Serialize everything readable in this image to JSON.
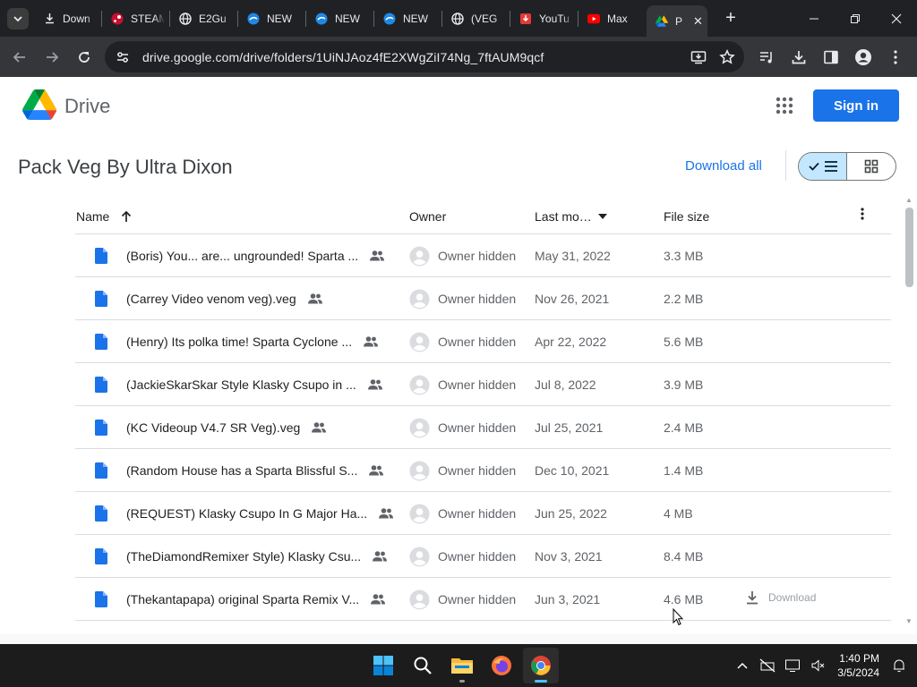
{
  "browser": {
    "tabs": [
      {
        "title": "Down",
        "icon": "download-icon"
      },
      {
        "title": "STEAM",
        "icon": "steam-icon"
      },
      {
        "title": "E2Gu",
        "icon": "globe-icon"
      },
      {
        "title": "NEW",
        "icon": "blue-cloud-icon"
      },
      {
        "title": "NEW",
        "icon": "blue-cloud-icon"
      },
      {
        "title": "NEW",
        "icon": "blue-cloud-icon"
      },
      {
        "title": "(VEG",
        "icon": "globe-icon"
      },
      {
        "title": "YouTu",
        "icon": "red-download-icon"
      },
      {
        "title": "Max",
        "icon": "youtube-icon"
      },
      {
        "title": "P",
        "icon": "drive-icon",
        "active": true
      }
    ],
    "url": "drive.google.com/drive/folders/1UiNJAoz4fE2XWgZiI74Ng_7ftAUM9qcf"
  },
  "drive": {
    "app_name": "Drive",
    "sign_in": "Sign in",
    "folder_title": "Pack Veg By Ultra Dixon",
    "download_all": "Download all",
    "columns": {
      "name": "Name",
      "owner": "Owner",
      "last_modified": "Last mo…",
      "file_size": "File size"
    },
    "files": [
      {
        "name": "(Boris) You... are... ungrounded! Sparta ...",
        "owner": "Owner hidden",
        "modified": "May 31, 2022",
        "size": "3.3 MB",
        "shared": true
      },
      {
        "name": "(Carrey Video venom veg).veg",
        "owner": "Owner hidden",
        "modified": "Nov 26, 2021",
        "size": "2.2 MB",
        "shared": true
      },
      {
        "name": "(Henry) Its polka time! Sparta Cyclone ...",
        "owner": "Owner hidden",
        "modified": "Apr 22, 2022",
        "size": "5.6 MB",
        "shared": true
      },
      {
        "name": "(JackieSkarSkar Style Klasky Csupo in ...",
        "owner": "Owner hidden",
        "modified": "Jul 8, 2022",
        "size": "3.9 MB",
        "shared": true
      },
      {
        "name": "(KC Videoup V4.7 SR Veg).veg",
        "owner": "Owner hidden",
        "modified": "Jul 25, 2021",
        "size": "2.4 MB",
        "shared": true
      },
      {
        "name": "(Random House has a Sparta Blissful S...",
        "owner": "Owner hidden",
        "modified": "Dec 10, 2021",
        "size": "1.4 MB",
        "shared": true
      },
      {
        "name": "(REQUEST) Klasky Csupo In G Major Ha...",
        "owner": "Owner hidden",
        "modified": "Jun 25, 2022",
        "size": "4 MB",
        "shared": true
      },
      {
        "name": "(TheDiamondRemixer Style) Klasky Csu...",
        "owner": "Owner hidden",
        "modified": "Nov 3, 2021",
        "size": "8.4 MB",
        "shared": true
      },
      {
        "name": "(Thekantapapa) original Sparta Remix V...",
        "owner": "Owner hidden",
        "modified": "Jun 3, 2021",
        "size": "4.6 MB",
        "shared": true,
        "hover_download": "Download"
      }
    ]
  },
  "taskbar": {
    "apps": [
      "windows-start-icon",
      "search-icon",
      "file-explorer-icon",
      "firefox-icon",
      "chrome-icon"
    ],
    "time": "1:40 PM",
    "date": "3/5/2024"
  },
  "colors": {
    "accent": "#1a73e8",
    "chrome_dark": "#202124",
    "toolbar": "#35363a",
    "toggle_selected": "#c2e7ff"
  }
}
